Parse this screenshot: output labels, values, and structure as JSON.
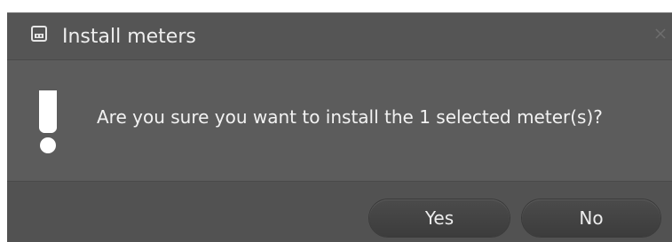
{
  "dialog": {
    "title": "Install meters",
    "title_icon": "window-icon",
    "close_icon": "close-icon",
    "message": "Are you sure you want to install the 1 selected meter(s)?",
    "message_icon": "exclamation-icon"
  },
  "buttons": {
    "yes_label": "Yes",
    "no_label": "No"
  },
  "colors": {
    "dialog_background": "#595959",
    "button_background": "#444444",
    "text": "#f2f2f2"
  }
}
